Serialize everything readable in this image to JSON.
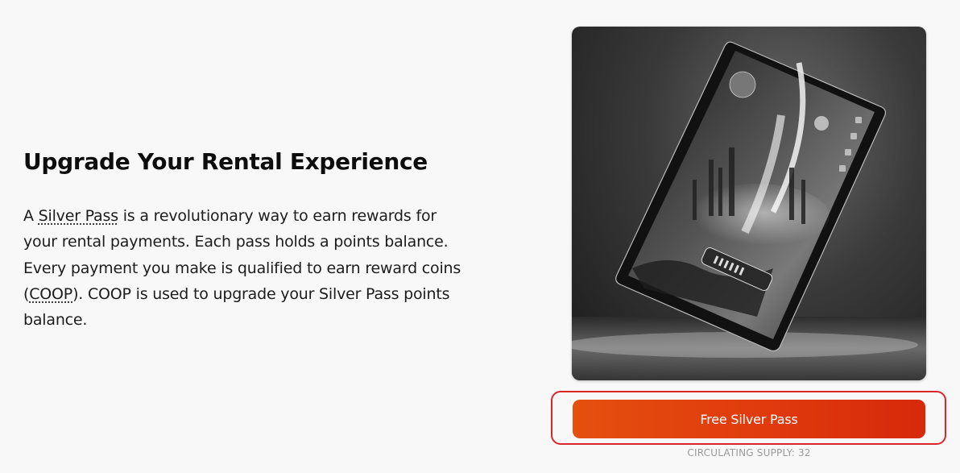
{
  "hero": {
    "title": "Upgrade Your Rental Experience",
    "body": {
      "p1": "A ",
      "term_silver_pass": "Silver Pass",
      "p2": " is a revolutionary way to earn rewards for your rental payments. Each pass holds a points balance. Every payment you make is qualified to earn reward coins (",
      "term_coop": "COOP",
      "p3": "). COOP is used to upgrade your Silver Pass points balance."
    }
  },
  "card_image": {
    "icon": "silver-pass-card-image"
  },
  "cta": {
    "label": "Free Silver Pass",
    "supply_text": "CIRCULATING SUPPLY: 32"
  },
  "colors": {
    "cta_start": "#e4500e",
    "cta_end": "#d6290b",
    "highlight_border": "#d9262a",
    "background": "#f8f8f8"
  }
}
